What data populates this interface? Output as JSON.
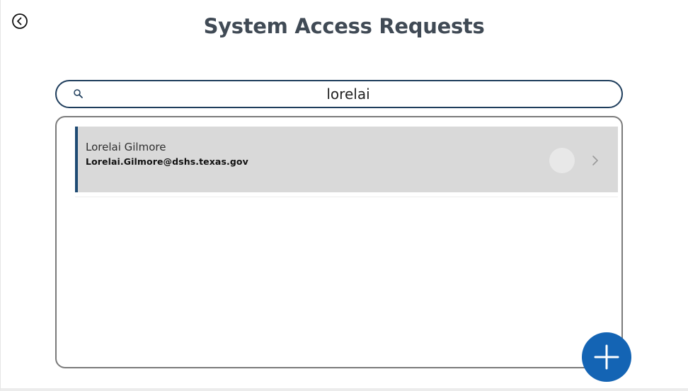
{
  "header": {
    "title": "System Access Requests",
    "back_icon": "chevron-left-circle-icon"
  },
  "search": {
    "value": "lorelai",
    "icon": "search-icon"
  },
  "results": [
    {
      "name": "Lorelai Gilmore",
      "email": "Lorelai.Gilmore@dshs.texas.gov",
      "chevron_icon": "chevron-right-icon"
    }
  ],
  "fab": {
    "icon": "plus-icon"
  },
  "colors": {
    "title": "#404a55",
    "search_border": "#1e3d5c",
    "item_background": "#d9d9d9",
    "item_accent": "#1e4a73",
    "fab_background": "#1464b4"
  }
}
